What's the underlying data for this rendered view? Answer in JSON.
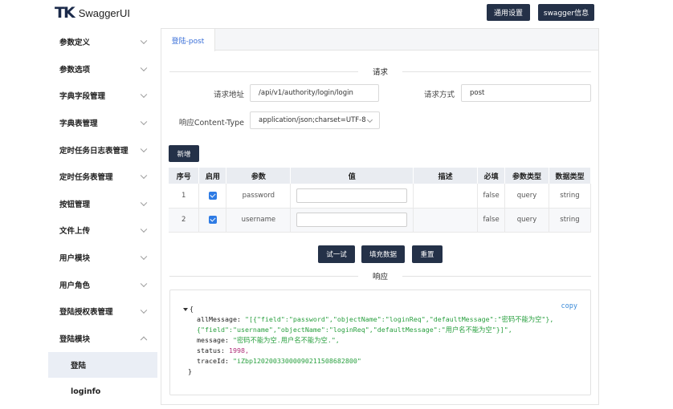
{
  "header": {
    "logo_mark": "TK",
    "logo_text": "SwaggerUI",
    "settings_button": "通用设置",
    "info_button": "swagger信息"
  },
  "sidebar": {
    "items": [
      {
        "label": "参数定义",
        "expanded": false
      },
      {
        "label": "参数选项",
        "expanded": false
      },
      {
        "label": "字典字段管理",
        "expanded": false
      },
      {
        "label": "字典表管理",
        "expanded": false
      },
      {
        "label": "定时任务日志表管理",
        "expanded": false
      },
      {
        "label": "定时任务表管理",
        "expanded": false
      },
      {
        "label": "按钮管理",
        "expanded": false
      },
      {
        "label": "文件上传",
        "expanded": false
      },
      {
        "label": "用户模块",
        "expanded": false
      },
      {
        "label": "用户角色",
        "expanded": false
      },
      {
        "label": "登陆授权表管理",
        "expanded": false
      },
      {
        "label": "登陆模块",
        "expanded": true
      }
    ],
    "subitems": [
      {
        "label": "登陆",
        "active": true
      },
      {
        "label": "loginfo",
        "active": false
      }
    ]
  },
  "tab": {
    "label": "登陆-post"
  },
  "request": {
    "section_title": "请求",
    "url_label": "请求地址",
    "url_value": "/api/v1/authority/login/login",
    "method_label": "请求方式",
    "method_value": "post",
    "content_type_label": "响应Content-Type",
    "content_type_value": "application/json;charset=UTF-8",
    "add_button": "新增"
  },
  "table": {
    "headers": [
      "序号",
      "启用",
      "参数",
      "值",
      "描述",
      "必填",
      "参数类型",
      "数据类型"
    ],
    "rows": [
      {
        "index": "1",
        "enabled": true,
        "param": "password",
        "value": "",
        "desc": "",
        "required": "false",
        "param_type": "query",
        "data_type": "string"
      },
      {
        "index": "2",
        "enabled": true,
        "param": "username",
        "value": "",
        "desc": "",
        "required": "false",
        "param_type": "query",
        "data_type": "string"
      }
    ]
  },
  "actions": {
    "try_button": "试一试",
    "fill_button": "填充数据",
    "reset_button": "重置"
  },
  "response": {
    "section_title": "响应",
    "copy_label": "copy",
    "open_brace": "{",
    "close_brace": "}",
    "all_message_key": "allMessage:",
    "all_message_value": "\"[{\"field\":\"password\",\"objectName\":\"loginReq\",\"defaultMessage\":\"密码不能为空\"},{\"field\":\"username\",\"objectName\":\"loginReq\",\"defaultMessage\":\"用户名不能为空\"}]\",",
    "message_key": "message:",
    "message_value": "\"密码不能为空.用户名不能为空.\",",
    "status_key": "status:",
    "status_value": "1998,",
    "trace_key": "traceId:",
    "trace_value": "\"iZbp12020033000090211508682800\""
  },
  "colors": {
    "primary_dark": "#243148",
    "tab_blue": "#3a6fd8",
    "checkbox_blue": "#2e7be4",
    "string_green": "#2aa040",
    "number_magenta": "#b0307a"
  }
}
